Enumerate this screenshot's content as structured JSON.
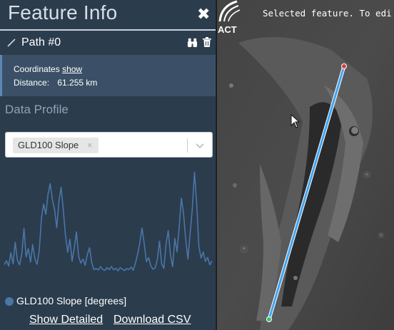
{
  "panel": {
    "title": "Feature Info",
    "close_glyph": "✖",
    "feature": {
      "name": "Path #0",
      "icon": "path-line-icon",
      "actions": [
        "binoculars-icon",
        "trash-icon"
      ]
    },
    "details": {
      "coords_label": "Coordinates",
      "coords_link": "show",
      "distance_label": "Distance:",
      "distance_value": "61.255 km"
    },
    "data_profile_heading": "Data Profile",
    "select": {
      "selected": "GLD100 Slope",
      "remove_glyph": "×"
    },
    "legend_label": "GLD100 Slope [degrees]",
    "legend_color": "#4a76a8",
    "links": {
      "show_detailed": "Show Detailed",
      "download_csv": "Download CSV"
    }
  },
  "chart_data": {
    "type": "line",
    "series": [
      {
        "name": "GLD100 Slope [degrees]",
        "values": [
          3.2,
          4.8,
          2.6,
          8.1,
          3.5,
          12.4,
          5.0,
          3.1,
          7.6,
          18.2,
          6.4,
          9.8,
          4.2,
          11.5,
          5.6,
          3.3,
          9.1,
          22.6,
          28.4,
          24.1,
          32.5,
          36.8,
          30.2,
          26.0,
          18.5,
          29.7,
          35.3,
          25.9,
          15.1,
          8.3,
          13.7,
          4.6,
          9.9,
          16.8,
          6.7,
          3.8,
          5.5,
          2.9,
          7.4,
          10.2,
          4.0,
          1.1,
          1.6,
          0.9,
          2.3,
          1.2,
          0.8,
          1.9,
          1.1,
          2.4,
          1.0,
          1.7,
          0.6,
          1.9,
          1.3,
          0.7,
          1.5,
          1.1,
          2.2,
          0.8,
          3.9,
          7.5,
          12.3,
          18.4,
          12.0,
          4.4,
          6.1,
          2.7,
          1.3,
          1.8,
          5.2,
          12.9,
          3.5,
          1.6,
          11.8,
          17.3,
          7.1,
          2.3,
          14.1,
          8.5,
          18.9,
          30.8,
          24.2,
          13.6,
          5.5,
          16.2,
          26.3,
          41.5,
          28.4,
          10.7,
          5.9,
          8.4,
          4.5,
          6.2,
          3.1,
          4.7
        ]
      }
    ],
    "ylim": [
      0,
      45
    ],
    "grid": false,
    "legend": "bottom"
  },
  "map": {
    "status_text": "Selected feature. To edi",
    "logo_text": "ACT",
    "line_color": "#3fa3f0",
    "start_marker_color": "#d04040",
    "end_marker_color": "#39c36a"
  }
}
